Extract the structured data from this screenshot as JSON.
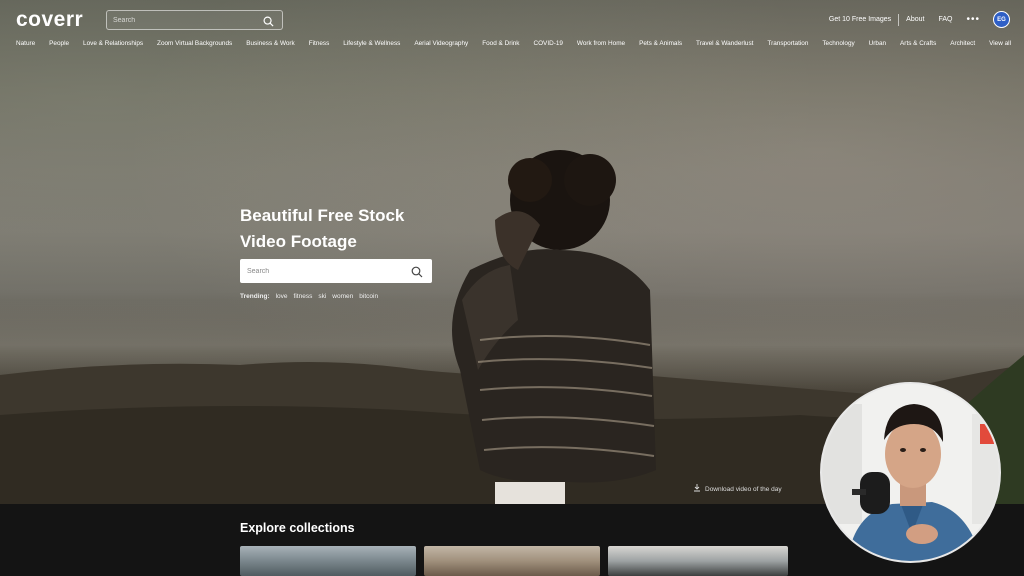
{
  "brand": {
    "logo_text": "coverr"
  },
  "header": {
    "search_placeholder": "Search",
    "links": [
      "Get 10 Free Images",
      "About",
      "FAQ"
    ],
    "more": "•••",
    "user_initials": "EG"
  },
  "categories": [
    "Nature",
    "People",
    "Love & Relationships",
    "Zoom Virtual Backgrounds",
    "Business & Work",
    "Fitness",
    "Lifestyle & Wellness",
    "Aerial Videography",
    "Food & Drink",
    "COVID-19",
    "Work from Home",
    "Pets & Animals",
    "Travel & Wanderlust",
    "Transportation",
    "Technology",
    "Urban",
    "Arts & Crafts",
    "Architect",
    "View all"
  ],
  "hero": {
    "title_line1": "Beautiful Free Stock",
    "title_line2": "Video Footage",
    "search_placeholder": "Search",
    "trending_label": "Trending:",
    "trending": [
      "love",
      "fitness",
      "ski",
      "women",
      "bitcoin"
    ],
    "download_label": "Download video of the day"
  },
  "explore": {
    "title": "Explore collections"
  },
  "colors": {
    "brand_accent": "#f2a93b",
    "avatar_bg": "#2f5fc6",
    "page_bg": "#141414"
  },
  "icons": [
    "search-icon",
    "download-icon"
  ]
}
